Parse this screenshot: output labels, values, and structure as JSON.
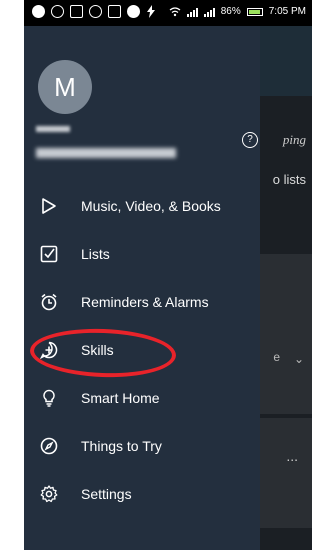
{
  "status_bar": {
    "battery_percent": "86%",
    "time": "7:05 PM"
  },
  "drawer": {
    "avatar_initial": "M",
    "items": [
      {
        "label": "Music, Video, & Books",
        "icon": "play-icon"
      },
      {
        "label": "Lists",
        "icon": "checkbox-icon"
      },
      {
        "label": "Reminders & Alarms",
        "icon": "alarm-icon"
      },
      {
        "label": "Skills",
        "icon": "skills-plus-icon"
      },
      {
        "label": "Smart Home",
        "icon": "lightbulb-icon"
      },
      {
        "label": "Things to Try",
        "icon": "compass-icon"
      },
      {
        "label": "Settings",
        "icon": "gear-icon"
      }
    ],
    "highlighted_item": "Skills",
    "highlight_color": "#e8232a"
  },
  "background": {
    "italic_text": "ping",
    "lists_text": "o lists",
    "dots": "..."
  }
}
